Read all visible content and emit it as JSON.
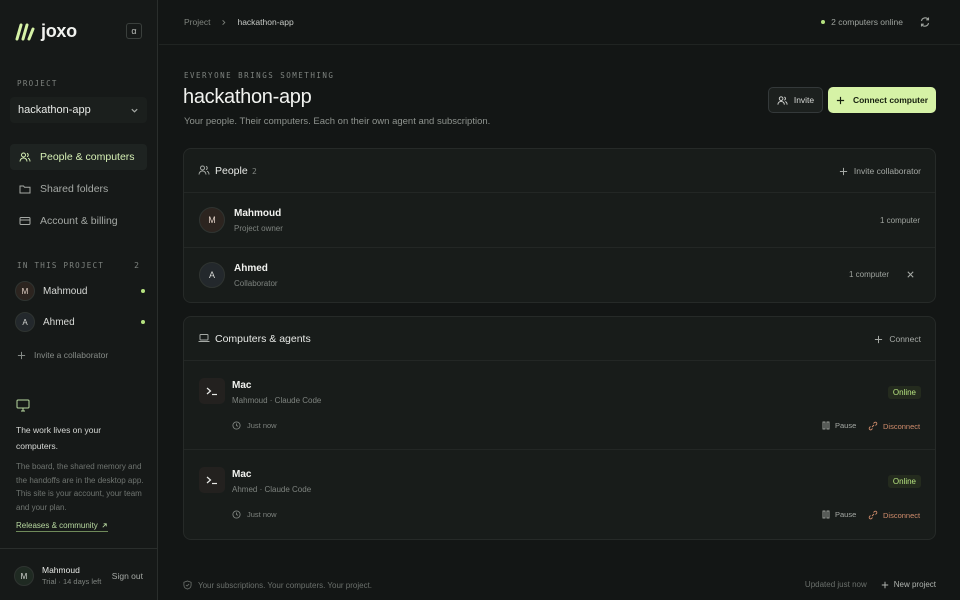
{
  "sidebar": {
    "brand": "joxo",
    "collapse_glyph": "α",
    "project_label": "PROJECT",
    "project_value": "hackathon-app",
    "nav": [
      {
        "label": "People & computers",
        "icon": "users-icon",
        "active": true
      },
      {
        "label": "Shared folders",
        "icon": "folder-icon",
        "active": false
      },
      {
        "label": "Account & billing",
        "icon": "card-icon",
        "active": false
      }
    ],
    "members_label": "IN THIS PROJECT",
    "members_count": "2",
    "members": [
      {
        "initial": "M",
        "name": "Mahmoud",
        "online": true
      },
      {
        "initial": "A",
        "name": "Ahmed",
        "online": true
      }
    ],
    "invite_label": "Invite a collaborator",
    "info": {
      "title": "The work lives on your computers.",
      "body": "The board, the shared memory and the handoffs are in the desktop app. This site is your account, your team and your plan.",
      "link": "Releases & community"
    },
    "account": {
      "initial": "M",
      "name": "Mahmoud",
      "plan": "Trial · 14 days left",
      "signout": "Sign out"
    }
  },
  "topbar": {
    "crumb_root": "Project",
    "crumb_current": "hackathon-app",
    "status": "2 computers online"
  },
  "header": {
    "eyebrow": "EVERYONE BRINGS SOMETHING",
    "title": "hackathon-app",
    "subtitle": "Your people. Their computers. Each on their own agent and subscription.",
    "invite_label": "Invite",
    "connect_label": "Connect computer"
  },
  "people": {
    "title": "People",
    "count": "2",
    "action": "Invite collaborator",
    "rows": [
      {
        "initial": "M",
        "name": "Mahmoud",
        "role": "Project owner",
        "computers": "1 computer"
      },
      {
        "initial": "A",
        "name": "Ahmed",
        "role": "Collaborator",
        "computers": "1 computer"
      }
    ]
  },
  "computers": {
    "title": "Computers & agents",
    "action": "Connect",
    "rows": [
      {
        "name": "Mac",
        "owner": "Mahmoud · Claude Code",
        "status": "Online",
        "time": "Just now",
        "pause": "Pause",
        "disconnect": "Disconnect"
      },
      {
        "name": "Mac",
        "owner": "Ahmed · Claude Code",
        "status": "Online",
        "time": "Just now",
        "pause": "Pause",
        "disconnect": "Disconnect"
      }
    ]
  },
  "footer": {
    "note": "Your subscriptions. Your computers. Your project.",
    "updated": "Updated just now",
    "new_project": "New project"
  },
  "colors": {
    "accent": "#d6f2a6",
    "online": "#b5e27f",
    "danger": "#d08c6c",
    "background": "#131615"
  }
}
